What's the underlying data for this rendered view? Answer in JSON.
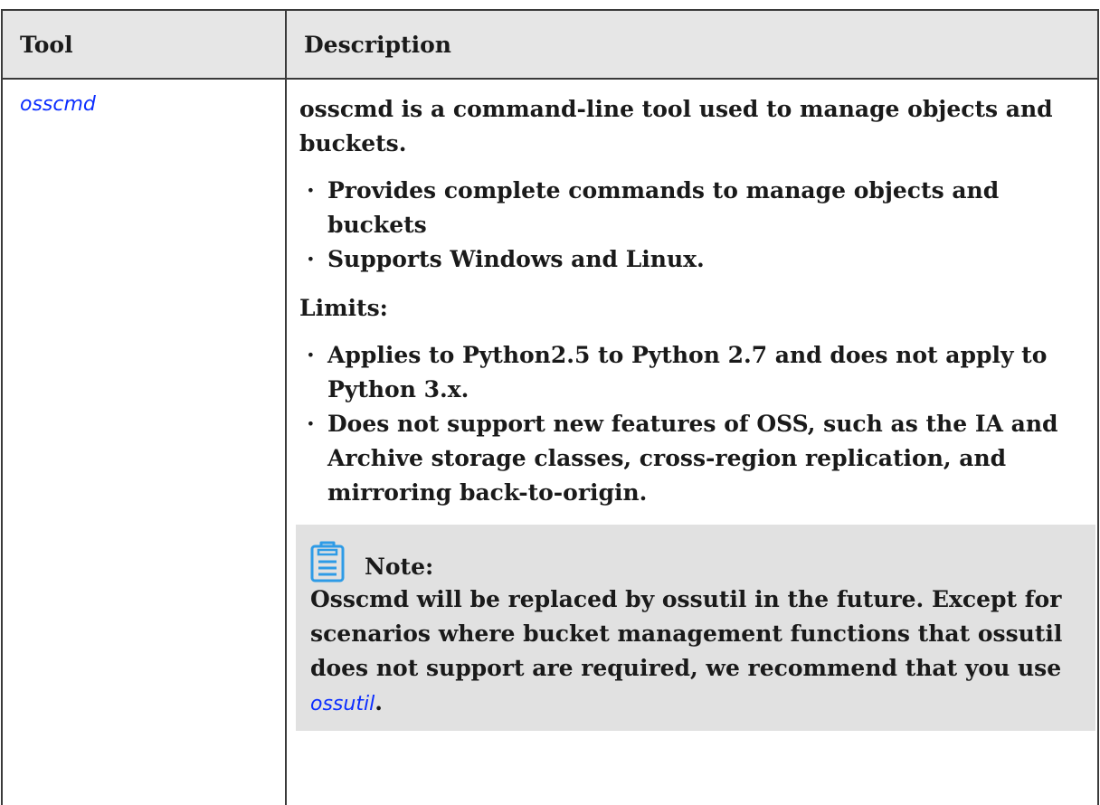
{
  "table": {
    "headers": {
      "tool": "Tool",
      "description": "Description"
    },
    "row": {
      "tool_link": "osscmd",
      "intro": "osscmd is a command-line tool used to manage objects and buckets.",
      "features": [
        "Provides complete commands to manage objects and buckets",
        "Supports Windows and Linux."
      ],
      "limits_label": "Limits:",
      "limits": [
        "Applies to Python2.5 to Python 2.7 and does not apply to Python 3.x.",
        "Does not support new features of OSS, such as the IA and  Archive storage classes, cross-region replication, and mirroring back-to-origin."
      ],
      "note": {
        "icon": "note-clipboard-icon",
        "title": "Note:",
        "text": "Osscmd will be replaced by ossutil in the future. Except for scenarios where bucket management functions that ossutil does not support are required, we recommend that you use ",
        "link": "ossutil",
        "end": "."
      }
    }
  },
  "colors": {
    "link": "#0b2dff",
    "header_bg": "#e6e6e6",
    "note_bg": "#e1e1e1",
    "icon": "#2e9be6"
  }
}
